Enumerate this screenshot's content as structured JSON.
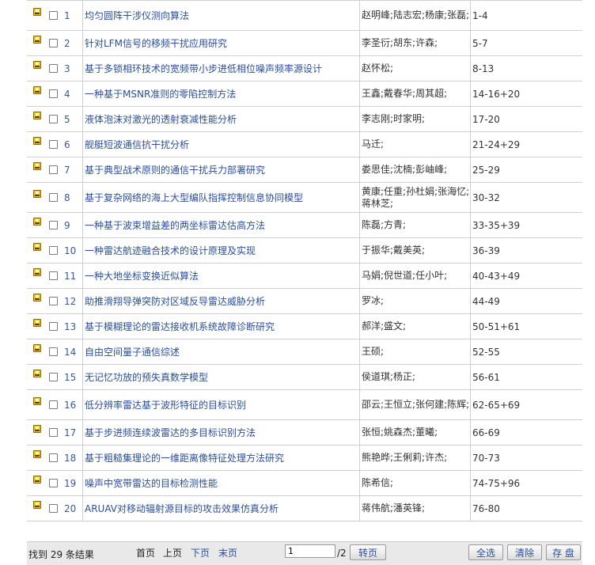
{
  "results": [
    {
      "num": "1",
      "title": "均匀圆阵干涉仪测向算法",
      "authors": "赵明峰;陆志宏;杨康;张磊;",
      "pages": "1-4",
      "tall": true
    },
    {
      "num": "2",
      "title": "针对LFM信号的移频干扰应用研究",
      "authors": "李圣衍;胡东;许森;",
      "pages": "5-7",
      "tall": false
    },
    {
      "num": "3",
      "title": "基于多锁相环技术的宽频带小步进低相位噪声频率源设计",
      "authors": "赵怀松;",
      "pages": "8-13",
      "tall": false
    },
    {
      "num": "4",
      "title": "一种基于MSNR准则的零陷控制方法",
      "authors": "王鑫;戴春华;周其超;",
      "pages": "14-16+20",
      "tall": false
    },
    {
      "num": "5",
      "title": "液体泡沫对激光的透射衰减性能分析",
      "authors": "李志刚;时家明;",
      "pages": "17-20",
      "tall": false
    },
    {
      "num": "6",
      "title": "舰艇短波通信抗干扰分析",
      "authors": "马迁;",
      "pages": "21-24+29",
      "tall": false
    },
    {
      "num": "7",
      "title": "基于典型战术原则的通信干扰兵力部署研究",
      "authors": "娄思佳;沈楠;彭岫峰;",
      "pages": "25-29",
      "tall": false
    },
    {
      "num": "8",
      "title": "基于复杂网络的海上大型编队指挥控制信息协同模型",
      "authors": "黄康;任重;孙杜娟;张海忆;蒋林芝;",
      "pages": "30-32",
      "tall": true
    },
    {
      "num": "9",
      "title": "一种基于波束增益差的两坐标雷达估高方法",
      "authors": "陈磊;方青;",
      "pages": "33-35+39",
      "tall": false
    },
    {
      "num": "10",
      "title": "一种雷达航迹融合技术的设计原理及实现",
      "authors": "于振华;戴美英;",
      "pages": "36-39",
      "tall": false
    },
    {
      "num": "11",
      "title": "一种大地坐标变换近似算法",
      "authors": "马娟;倪世道;任小叶;",
      "pages": "40-43+49",
      "tall": false
    },
    {
      "num": "12",
      "title": "助推滑翔导弹突防对区域反导雷达威胁分析",
      "authors": "罗冰;",
      "pages": "44-49",
      "tall": false
    },
    {
      "num": "13",
      "title": "基于模糊理论的雷达接收机系统故障诊断研究",
      "authors": "郝洋;盛文;",
      "pages": "50-51+61",
      "tall": false
    },
    {
      "num": "14",
      "title": "自由空间量子通信综述",
      "authors": "王硕;",
      "pages": "52-55",
      "tall": false
    },
    {
      "num": "15",
      "title": "无记忆功放的预失真数学模型",
      "authors": "侯道琪;杨正;",
      "pages": "56-61",
      "tall": false
    },
    {
      "num": "16",
      "title": "低分辨率雷达基于波形特征的目标识别",
      "authors": "邵云;王恒立;张何建;陈辉;",
      "pages": "62-65+69",
      "tall": true
    },
    {
      "num": "17",
      "title": "基于步进频连续波雷达的多目标识别方法",
      "authors": "张恒;姚森杰;董曦;",
      "pages": "66-69",
      "tall": false
    },
    {
      "num": "18",
      "title": "基于粗糙集理论的一维距离像特征处理方法研究",
      "authors": "熊艳晔;王俐莉;许杰;",
      "pages": "70-73",
      "tall": false
    },
    {
      "num": "19",
      "title": "噪声中宽带雷达的目标检测性能",
      "authors": "陈希信;",
      "pages": "74-75+96",
      "tall": false
    },
    {
      "num": "20",
      "title": "ARUAV对移动辐射源目标的攻击效果仿真分析",
      "authors": "蒋伟航;潘英锋;",
      "pages": "76-80",
      "tall": false
    }
  ],
  "footer": {
    "count_text": "找到 29 条结果",
    "first": "首页",
    "prev": "上页",
    "next": "下页",
    "last": "末页",
    "page_input": "1",
    "total_pages": "/2",
    "goto": "转页",
    "select_all": "全选",
    "clear": "清除",
    "save": "存 盘"
  },
  "colors": {
    "link": "#2a4e9c",
    "border": "#cfcfcf",
    "footer_bg": "#e9e9e9",
    "icon": "#f5c419"
  }
}
